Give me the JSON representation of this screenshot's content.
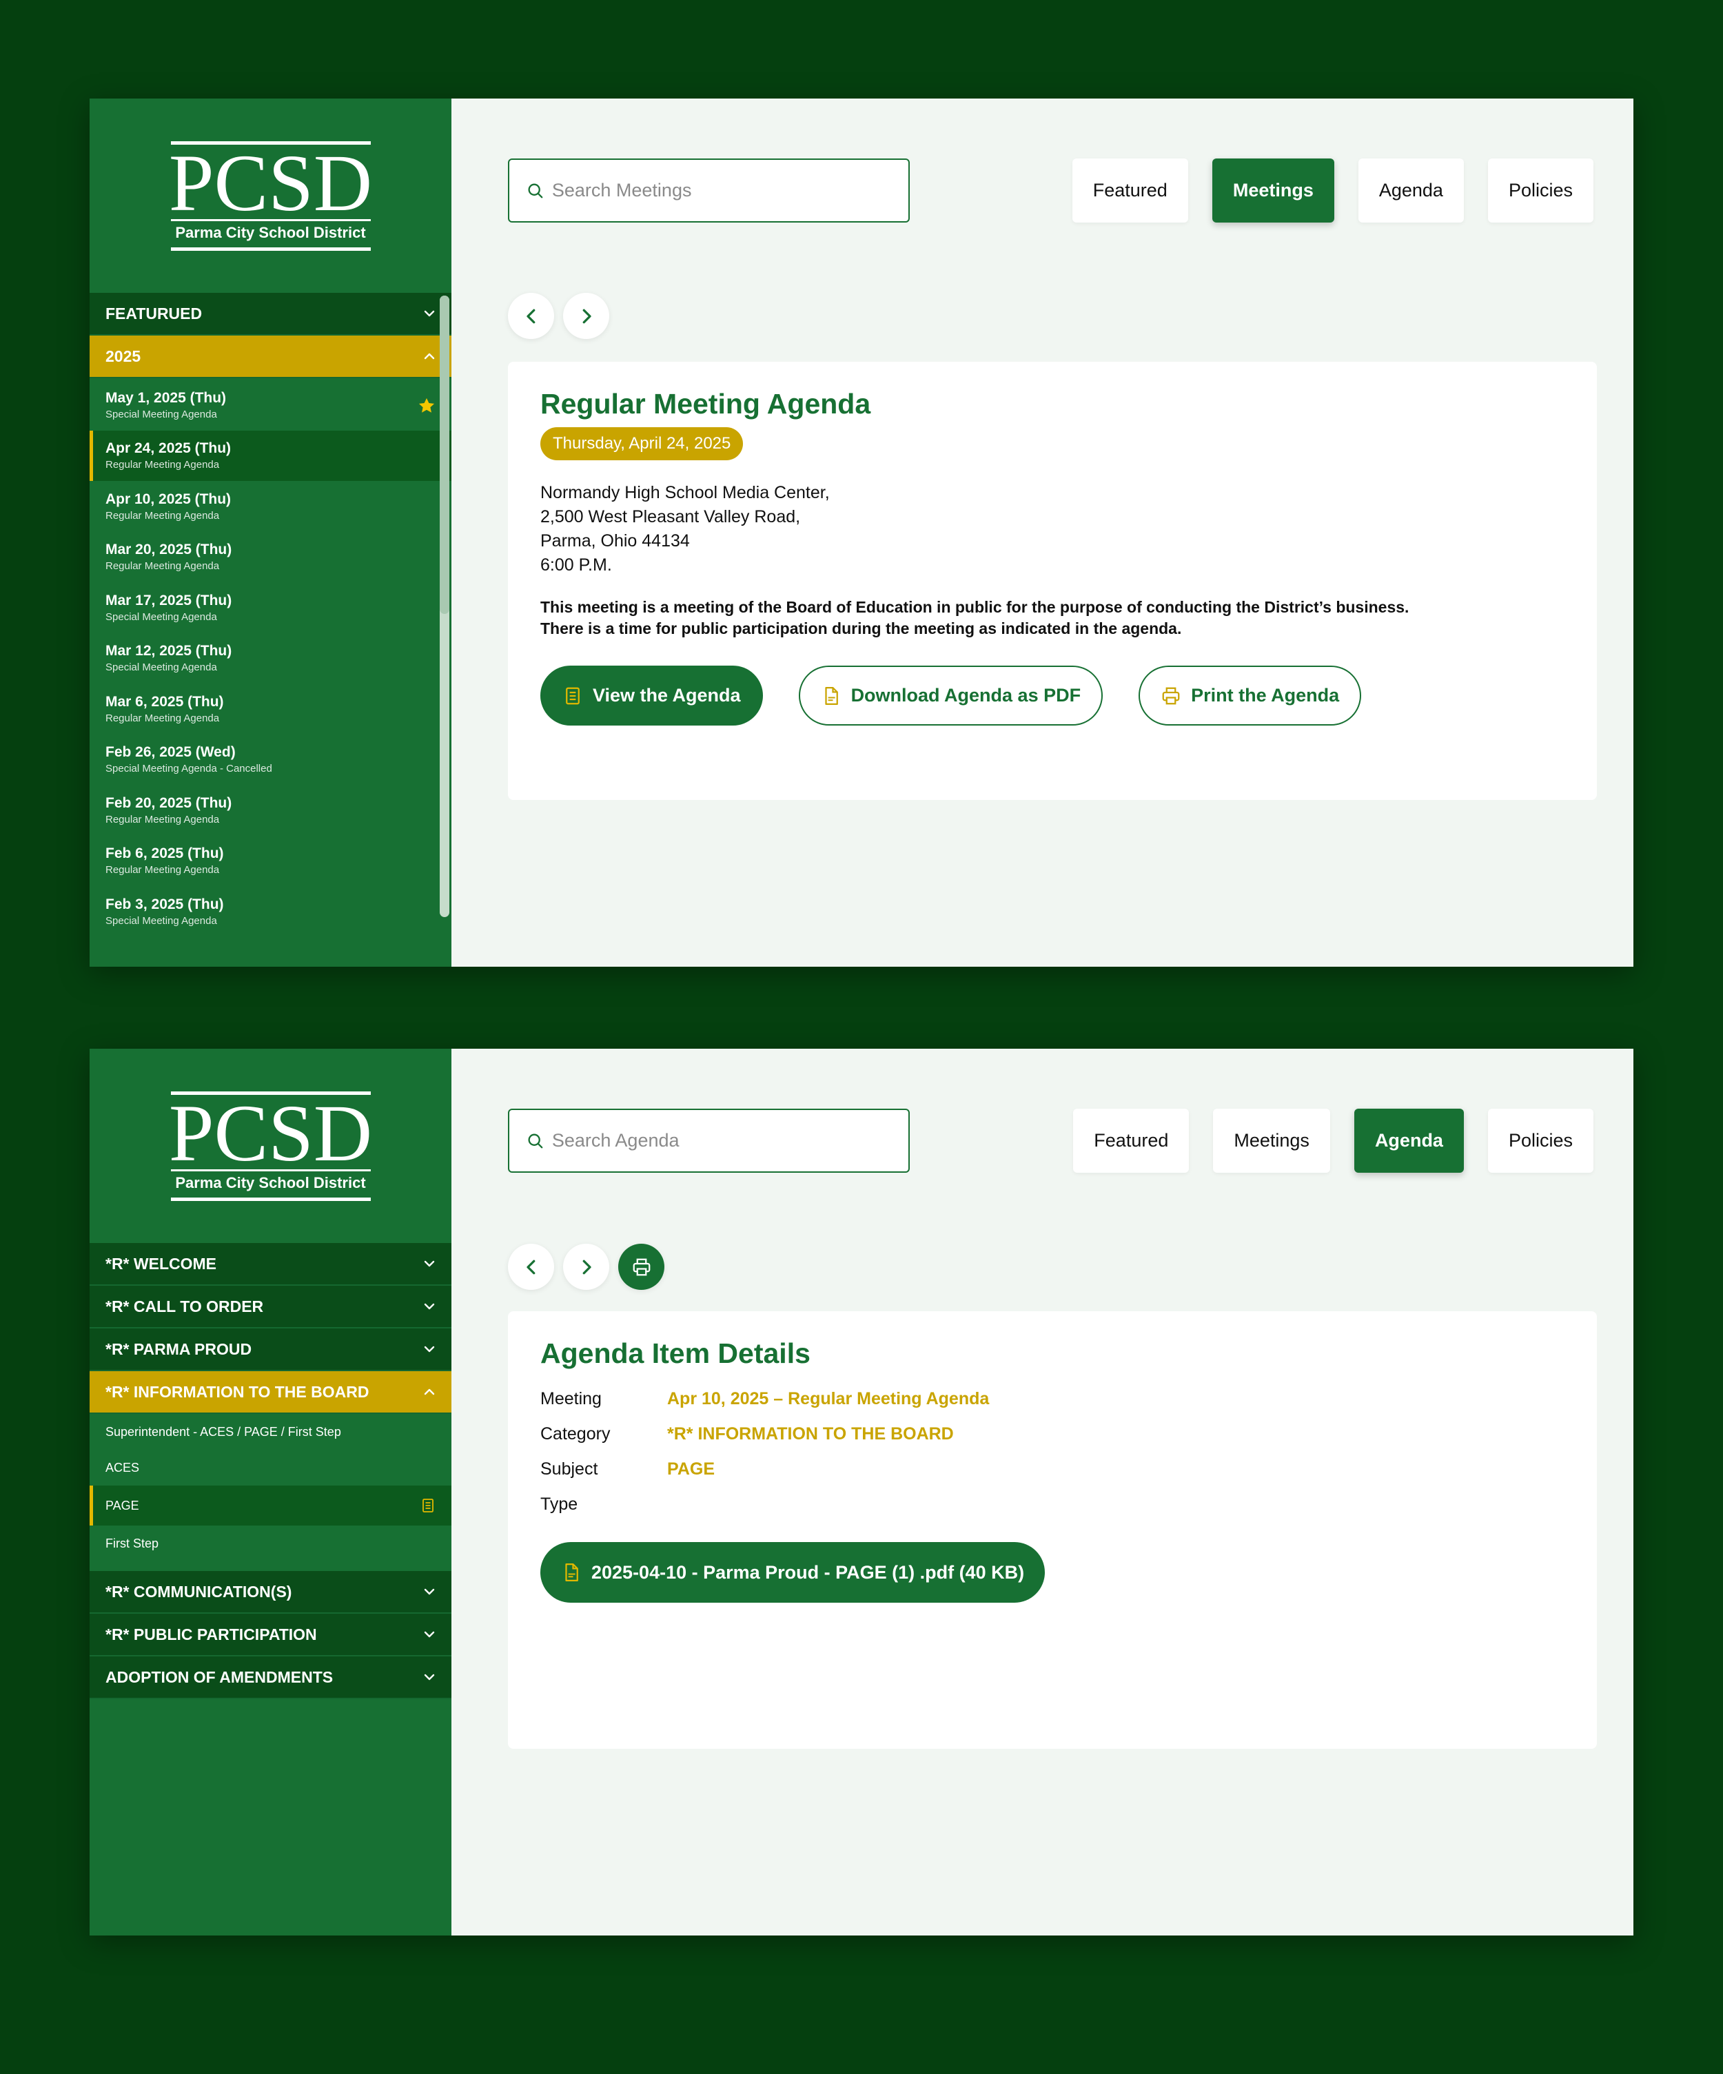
{
  "logo": {
    "mark": "PCSD",
    "subtitle": "Parma City School District"
  },
  "colors": {
    "green": "#177033",
    "dark_green": "#05400f",
    "gold": "#c9a400"
  },
  "screen1": {
    "search": {
      "placeholder": "Search Meetings"
    },
    "tabs": [
      {
        "label": "Featured",
        "active": false
      },
      {
        "label": "Meetings",
        "active": true
      },
      {
        "label": "Agenda",
        "active": false
      },
      {
        "label": "Policies",
        "active": false
      }
    ],
    "sidebar": {
      "featured_label": "FEATURUED",
      "year_label": "2025",
      "meetings": [
        {
          "date": "May 1, 2025 (Thu)",
          "type": "Special Meeting Agenda",
          "starred": true
        },
        {
          "date": "Apr 24, 2025 (Thu)",
          "type": "Regular Meeting Agenda",
          "active": true
        },
        {
          "date": "Apr 10, 2025 (Thu)",
          "type": "Regular Meeting Agenda"
        },
        {
          "date": "Mar 20, 2025 (Thu)",
          "type": "Regular Meeting Agenda"
        },
        {
          "date": "Mar 17, 2025 (Thu)",
          "type": "Special Meeting Agenda"
        },
        {
          "date": "Mar 12, 2025 (Thu)",
          "type": "Special Meeting Agenda"
        },
        {
          "date": "Mar 6, 2025 (Thu)",
          "type": "Regular Meeting Agenda"
        },
        {
          "date": "Feb 26, 2025 (Wed)",
          "type": "Special Meeting Agenda - Cancelled"
        },
        {
          "date": "Feb 20, 2025 (Thu)",
          "type": "Regular Meeting Agenda"
        },
        {
          "date": "Feb 6, 2025 (Thu)",
          "type": "Regular Meeting Agenda"
        },
        {
          "date": "Feb 3, 2025 (Thu)",
          "type": "Special Meeting Agenda"
        }
      ]
    },
    "card": {
      "title": "Regular Meeting Agenda",
      "date": "Thursday, April 24, 2025",
      "address": [
        "Normandy High School Media Center,",
        "2,500 West Pleasant Valley Road,",
        "Parma, Ohio 44134",
        "6:00 P.M."
      ],
      "description_1": "This meeting is a  meeting of the Board of Education in public for the purpose of conducting the District’s business.",
      "description_2": "There is a time for public participation during the meeting as indicated in the agenda.",
      "view_label": "View the Agenda",
      "download_label": "Download Agenda as PDF",
      "print_label": "Print the Agenda"
    }
  },
  "screen2": {
    "search": {
      "placeholder": "Search Agenda"
    },
    "tabs": [
      {
        "label": "Featured",
        "active": false
      },
      {
        "label": "Meetings",
        "active": false
      },
      {
        "label": "Agenda",
        "active": true
      },
      {
        "label": "Policies",
        "active": false
      }
    ],
    "sidebar": {
      "sections_before": [
        "*R* WELCOME",
        "*R* CALL TO ORDER",
        "*R* PARMA PROUD"
      ],
      "open_section": "*R* INFORMATION TO THE BOARD",
      "sub_items": [
        {
          "label": "Superintendent - ACES / PAGE / First Step"
        },
        {
          "label": "ACES"
        },
        {
          "label": "PAGE",
          "active": true
        },
        {
          "label": "First Step"
        }
      ],
      "sections_after": [
        "*R* COMMUNICATION(S)",
        "*R* PUBLIC PARTICIPATION",
        "ADOPTION OF AMENDMENTS"
      ]
    },
    "card": {
      "title": "Agenda Item Details",
      "meeting_label": "Meeting",
      "meeting_value": "Apr 10, 2025 – Regular Meeting Agenda",
      "category_label": "Category",
      "category_value": "*R* INFORMATION TO THE BOARD",
      "subject_label": "Subject",
      "subject_value": "PAGE",
      "type_label": "Type",
      "type_value": "",
      "file_label": "2025-04-10  - Parma Proud - PAGE  (1) .pdf (40 KB)"
    }
  }
}
